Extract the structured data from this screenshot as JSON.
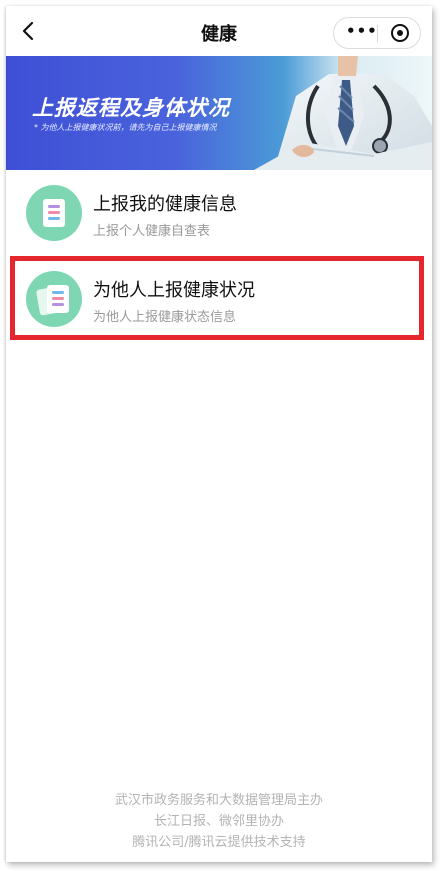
{
  "nav": {
    "title": "健康"
  },
  "banner": {
    "title": "上报返程及身体状况",
    "subtitle": "* 为他人上报健康状况前，请先为自己上报健康情况"
  },
  "items": [
    {
      "title": "上报我的健康信息",
      "subtitle": "上报个人健康自查表"
    },
    {
      "title": "为他人上报健康状况",
      "subtitle": "为他人上报健康状态信息"
    }
  ],
  "footer": {
    "line1": "武汉市政务服务和大数据管理局主办",
    "line2": "长江日报、微邻里协办",
    "line3": "腾讯公司/腾讯云提供技术支持"
  },
  "colors": {
    "accent_green": "#7ed7b2",
    "highlight_red": "#e5262c",
    "banner_blue": "#3e4fd6"
  },
  "icons": [
    "back-icon",
    "more-icon",
    "close-circle-icon",
    "health-form-icon",
    "others-form-icon"
  ]
}
